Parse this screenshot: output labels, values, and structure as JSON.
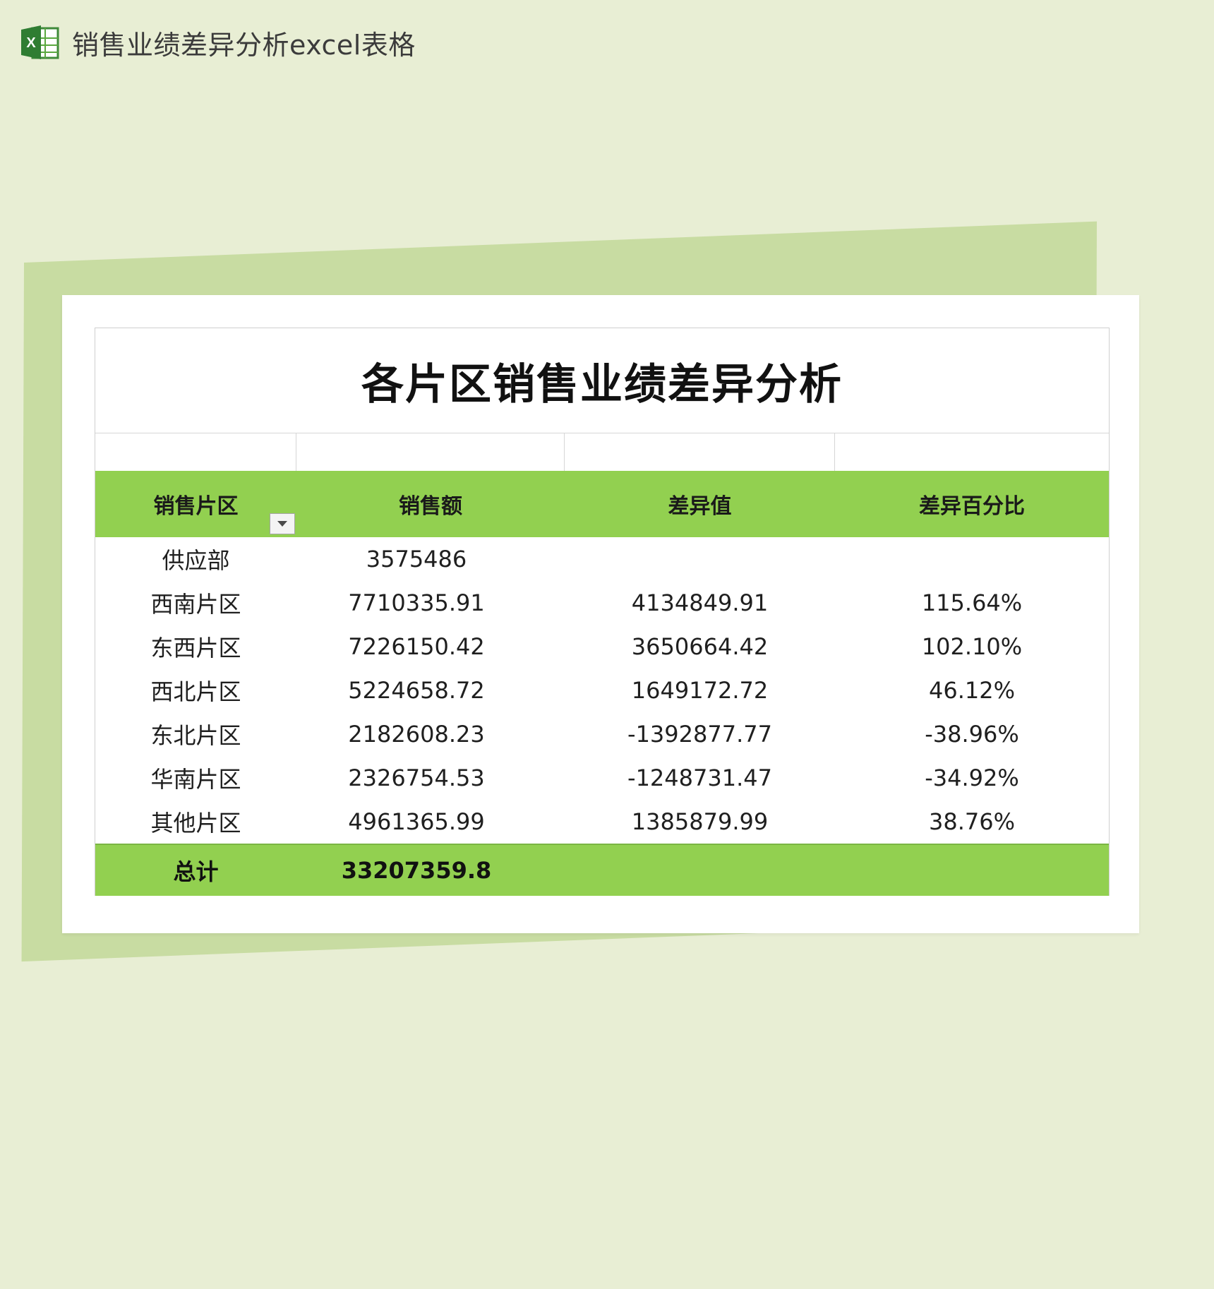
{
  "header": {
    "app_icon": "excel-icon",
    "title": "销售业绩差异分析excel表格"
  },
  "document": {
    "title": "各片区销售业绩差异分析",
    "columns": [
      "销售片区",
      "销售额",
      "差异值",
      "差异百分比"
    ],
    "rows": [
      {
        "region": "供应部",
        "sales": "3575486",
        "diff": "",
        "pct": ""
      },
      {
        "region": "西南片区",
        "sales": "7710335.91",
        "diff": "4134849.91",
        "pct": "115.64%"
      },
      {
        "region": "东西片区",
        "sales": "7226150.42",
        "diff": "3650664.42",
        "pct": "102.10%"
      },
      {
        "region": "西北片区",
        "sales": "5224658.72",
        "diff": "1649172.72",
        "pct": "46.12%"
      },
      {
        "region": "东北片区",
        "sales": "2182608.23",
        "diff": "-1392877.77",
        "pct": "-38.96%"
      },
      {
        "region": "华南片区",
        "sales": "2326754.53",
        "diff": "-1248731.47",
        "pct": "-34.92%"
      },
      {
        "region": "其他片区",
        "sales": "4961365.99",
        "diff": "1385879.99",
        "pct": "38.76%"
      }
    ],
    "total": {
      "label": "总计",
      "sales": "33207359.8"
    }
  },
  "colors": {
    "background": "#e8eed4",
    "header_fill": "#92d050",
    "back_sheet": "#c8dca2"
  }
}
